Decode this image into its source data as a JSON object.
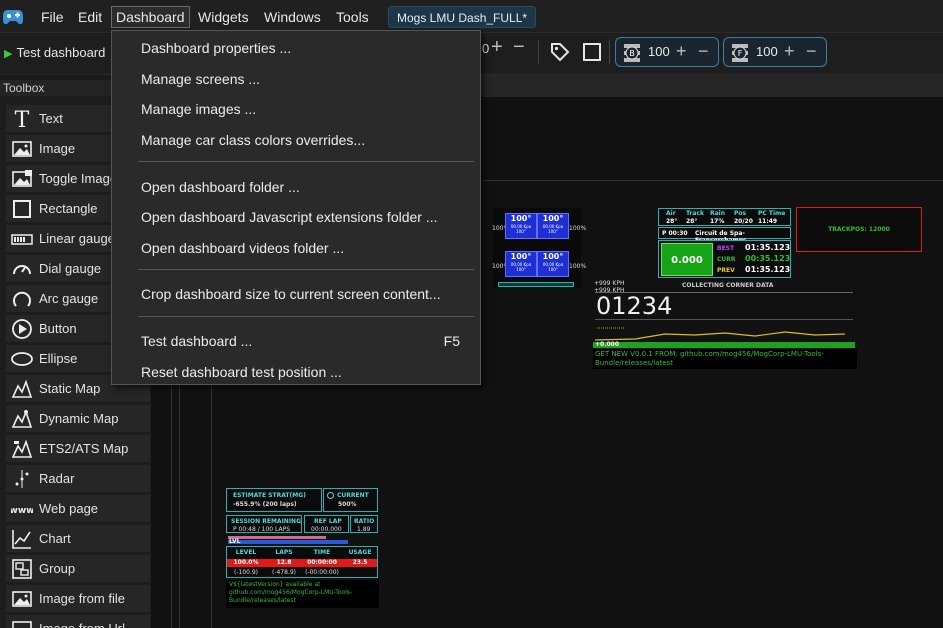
{
  "menubar": {
    "items": [
      "File",
      "Edit",
      "Dashboard",
      "Widgets",
      "Windows",
      "Tools"
    ],
    "active_item": "Dashboard",
    "file_tab": "Mogs LMU Dash_FULL*"
  },
  "toolbar": {
    "test_label": "Test dashboard",
    "zoom_fragment": "0",
    "layer_values": [
      "100",
      "100"
    ]
  },
  "dropdown": {
    "items": [
      "Dashboard properties ...",
      "Manage screens ...",
      "Manage images ...",
      "Manage car class colors overrides...",
      "Open dashboard folder ...",
      "Open dashboard Javascript extensions folder ...",
      "Open dashboard videos folder ...",
      "Crop dashboard size to current screen content...",
      "Test dashboard ...",
      "Reset dashboard test position ..."
    ],
    "test_shortcut": "F5"
  },
  "toolbox": {
    "title": "Toolbox",
    "items": [
      {
        "label": "Text",
        "icon": "text-icon"
      },
      {
        "label": "Image",
        "icon": "image-icon"
      },
      {
        "label": "Toggle Image",
        "icon": "toggle-image-icon"
      },
      {
        "label": "Rectangle",
        "icon": "rectangle-icon"
      },
      {
        "label": "Linear gauge",
        "icon": "linear-gauge-icon"
      },
      {
        "label": "Dial gauge",
        "icon": "dial-gauge-icon"
      },
      {
        "label": "Arc gauge",
        "icon": "arc-gauge-icon"
      },
      {
        "label": "Button",
        "icon": "button-icon"
      },
      {
        "label": "Ellipse",
        "icon": "ellipse-icon"
      },
      {
        "label": "Static Map",
        "icon": "static-map-icon"
      },
      {
        "label": "Dynamic Map",
        "icon": "dynamic-map-icon"
      },
      {
        "label": "ETS2/ATS Map",
        "icon": "ets2-map-icon"
      },
      {
        "label": "Radar",
        "icon": "radar-icon"
      },
      {
        "label": "Web page",
        "icon": "web-page-icon"
      },
      {
        "label": "Chart",
        "icon": "chart-icon"
      },
      {
        "label": "Group",
        "icon": "group-icon"
      },
      {
        "label": "Image from file",
        "icon": "image-from-file-icon"
      },
      {
        "label": "Image from Url",
        "icon": "image-from-url-icon"
      }
    ]
  },
  "widgets": {
    "tyres": {
      "temps": [
        "100°",
        "100°",
        "100°",
        "100°"
      ],
      "sub": [
        "00.00 Kpa",
        "00.00 Kpa",
        "00.00 Kpa",
        "00.00 Kpa"
      ],
      "wear": [
        "100°",
        "100°",
        "100°",
        "100°"
      ],
      "side_left": "100%",
      "side_right": "100%"
    },
    "weather": {
      "headers": [
        "Air",
        "Track",
        "Rain",
        "Pos",
        "PC Time"
      ],
      "values": [
        "28°",
        "28°",
        "17%",
        "20/20",
        "11:49"
      ],
      "session_time": "P 00:30",
      "track_name": "Circuit de Spa-Francorchamps",
      "delta": "0.000",
      "labels": [
        "BEST",
        "CURR",
        "PREV"
      ],
      "times": [
        "01:35.123",
        "00:35.123",
        "01:35.123"
      ]
    },
    "trackpos": "TRACKPOS: 12000",
    "corner": {
      "title": "COLLECTING CORNER DATA",
      "kph_top": "+999 KPH",
      "kph_bot": "+999 KPH",
      "big_value": "01234",
      "green_value": "+0.000",
      "update_text": "GET NEW V0.0.1 FROM: github.com/mog456/MogCorp-LMU-Tools-Bundle/releases/latest"
    },
    "fuel": {
      "header": "ESTIMATE STRAT(MG)",
      "header_sub": "-655.9% (200 laps)",
      "current_label": "CURRENT",
      "current_value": "500%",
      "session_remaining": "SESSION REMAINING",
      "session_value": "P 00:48 / 100 LAPS",
      "ref_lap": "REF LAP",
      "ref_value": "00:00.000",
      "ratio": "RATIO",
      "ratio_value": "1.89",
      "lvl": "LVL",
      "cols": [
        "LEVEL",
        "LAPS",
        "TIME",
        "USAGE"
      ],
      "row1": [
        "100.0%",
        "12.8",
        "00:00:00",
        "23.5"
      ],
      "row2": [
        "(-100.9)",
        "(-478.9)",
        "(-00:00:00)",
        ""
      ],
      "version_text": "V${latestVersion} available at github.com/mog456/MogCorp-LMU-Tools-Bundle/releases/latest"
    }
  },
  "colors": {
    "accent": "#3b7ea1",
    "play": "#3cc84a",
    "tyre": "#1f2fd6",
    "trackpos_border": "#e01a1a",
    "dash_green": "#2fbf2f",
    "dash_cyan": "#2ab0b0",
    "dash_yellow": "#d4c21a"
  }
}
